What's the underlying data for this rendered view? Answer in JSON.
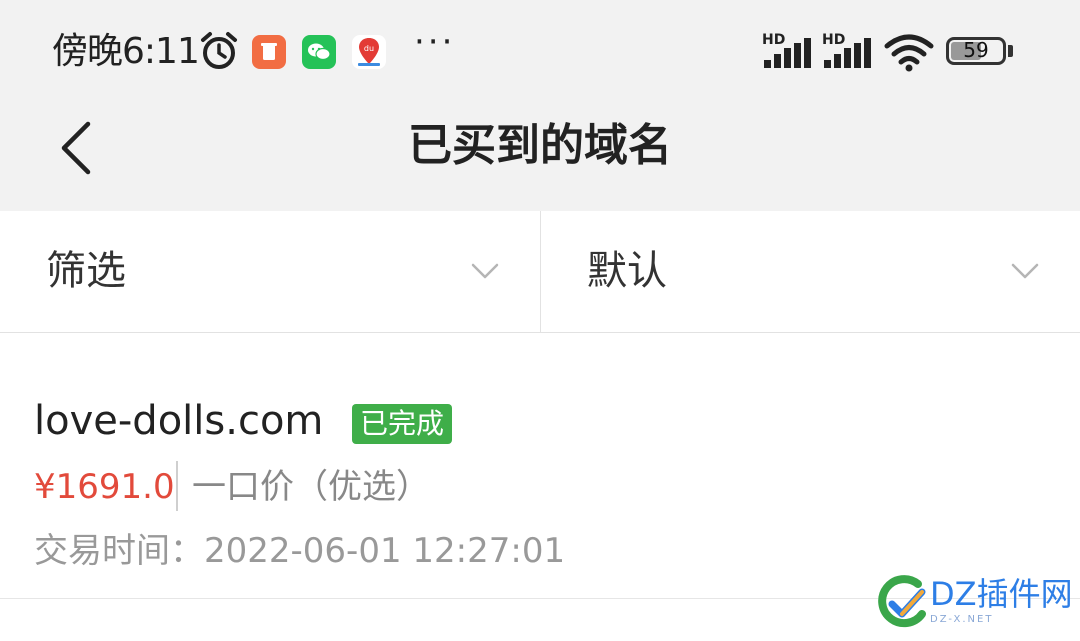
{
  "status_bar": {
    "time": "傍晚6:11",
    "hd_label": "HD",
    "battery": "59",
    "battery_level": 0.59,
    "icons": [
      "alarm-icon",
      "app-orange-icon",
      "wechat-icon",
      "maps-du-icon",
      "more-dots-icon",
      "signal-icon",
      "signal-icon",
      "wifi-icon",
      "battery-icon"
    ]
  },
  "nav": {
    "title": "已买到的域名",
    "back_icon": "chevron-left-icon"
  },
  "filters": {
    "left_label": "筛选",
    "right_label": "默认",
    "icon": "chevron-down-icon"
  },
  "order": {
    "domain": "love-dolls.com",
    "status": "已完成",
    "price": "¥1691.0",
    "price_type": "一口价（优选）",
    "trade_label": "交易时间：",
    "trade_time": "2022-06-01 12:27:01"
  },
  "watermark": {
    "text": "DZ插件网",
    "sub": "DZ-X.NET"
  },
  "colors": {
    "price_red": "#e24a3b",
    "badge_green": "#3fae49",
    "wechat_green": "#25c258",
    "app_orange": "#f26d43",
    "watermark_blue": "#2d7ee6"
  }
}
